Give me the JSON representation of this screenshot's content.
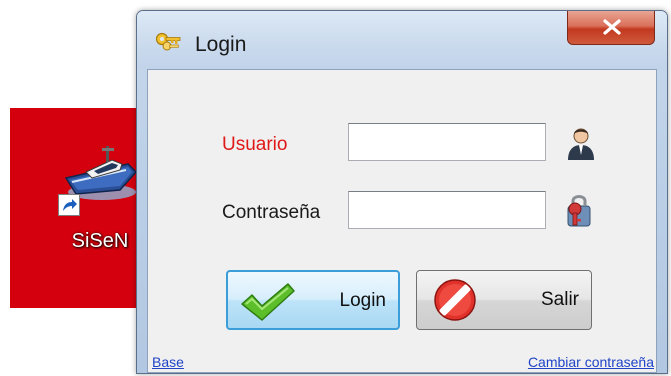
{
  "desktop": {
    "shortcut_label": "SiSeN",
    "shortcut_icon": "boat-icon",
    "tile_color": "#d4000e"
  },
  "window": {
    "title": "Login",
    "title_icon": "keys-icon",
    "close_icon": "close-icon"
  },
  "form": {
    "usuario_label": "Usuario",
    "usuario_value": "",
    "contrasena_label": "Contraseña",
    "contrasena_value": "",
    "user_icon": "user-icon",
    "password_icon": "key-lock-icon"
  },
  "buttons": {
    "login_label": "Login",
    "login_icon": "checkmark-icon",
    "salir_label": "Salir",
    "salir_icon": "no-entry-icon"
  },
  "links": {
    "base": "Base",
    "change_password": "Cambiar contraseña"
  },
  "colors": {
    "required_label": "#e01818",
    "link": "#1f44c8",
    "focus_border": "#3c9ed8"
  }
}
